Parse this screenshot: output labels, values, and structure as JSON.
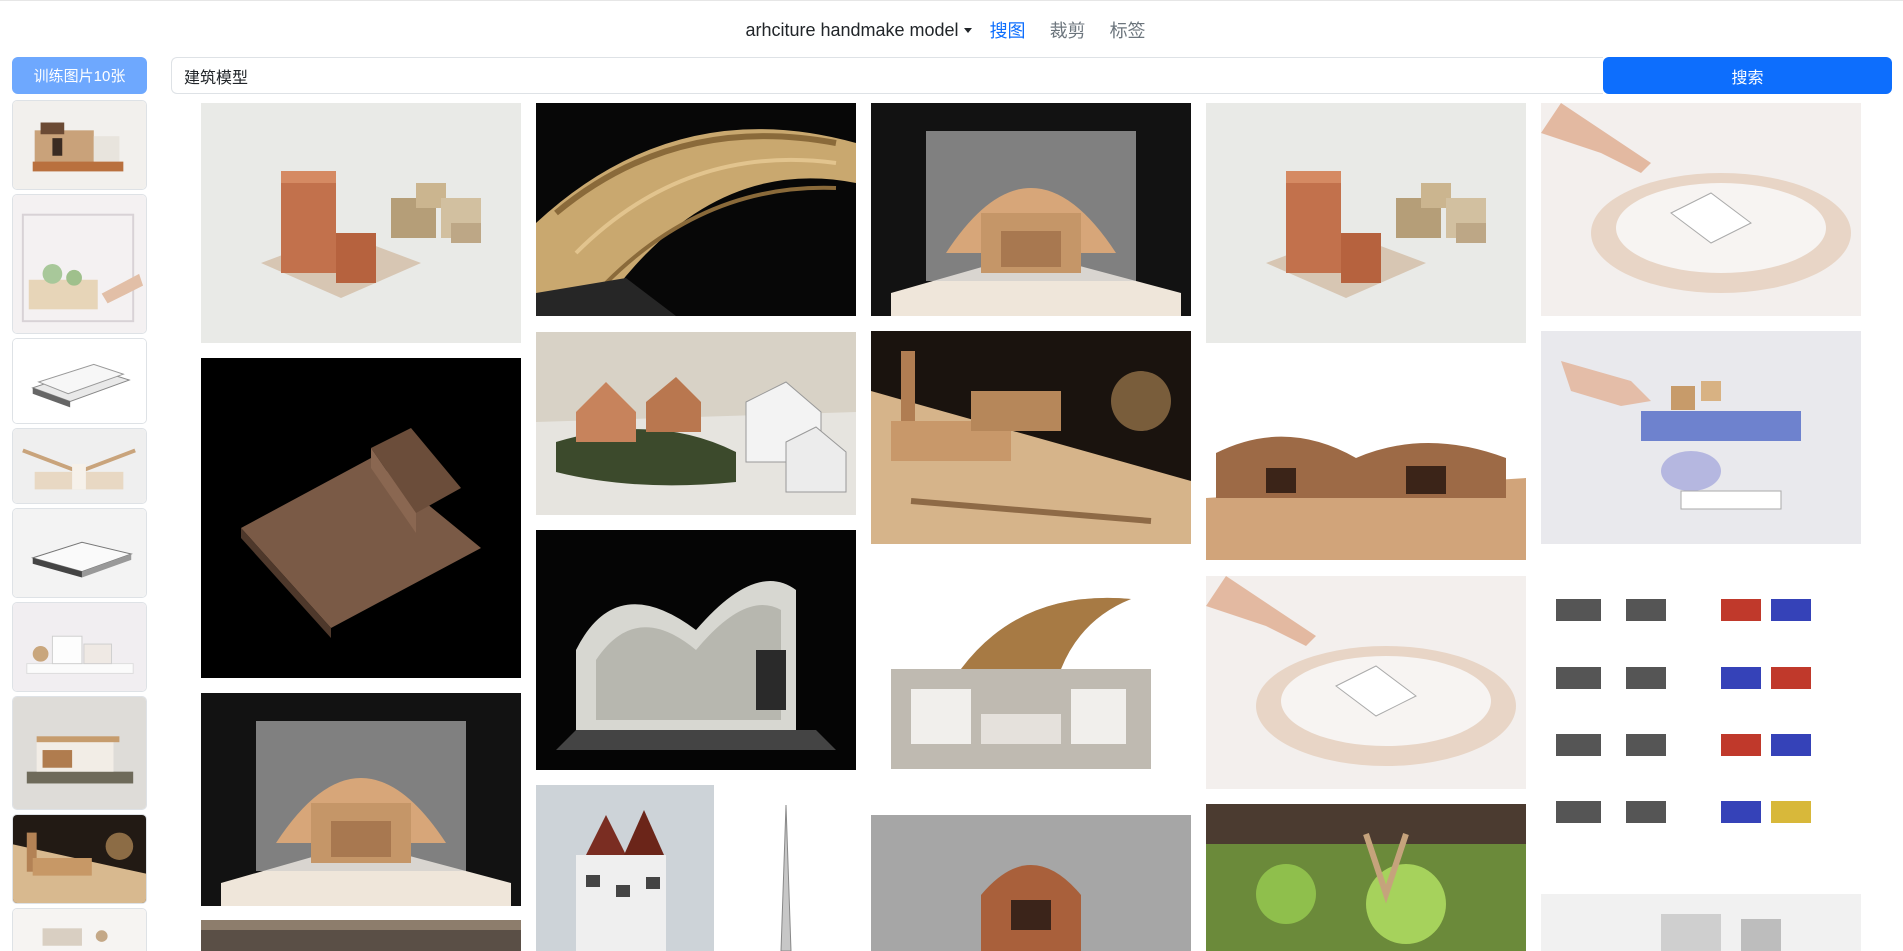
{
  "nav": {
    "dataset_label": "arhciture handmake model",
    "tabs": [
      {
        "label": "搜图",
        "active": true
      },
      {
        "label": "裁剪",
        "active": false
      },
      {
        "label": "标签",
        "active": false
      }
    ]
  },
  "sidebar": {
    "train_button": "训练图片10张",
    "thumbnails": [
      {
        "name": "cutaway-house-model"
      },
      {
        "name": "acrylic-box-model-with-hand"
      },
      {
        "name": "white-stacked-slabs-model"
      },
      {
        "name": "butterfly-roof-model"
      },
      {
        "name": "white-thin-block-model"
      },
      {
        "name": "white-cube-house-model"
      },
      {
        "name": "wooden-pavilion-model"
      },
      {
        "name": "factory-site-model"
      },
      {
        "name": "white-site-model"
      }
    ]
  },
  "search": {
    "query": "建筑模型",
    "button": "搜索"
  },
  "results": [
    {
      "name": "terracotta-block-model"
    },
    {
      "name": "wooden-lattice-arch-model"
    },
    {
      "name": "timber-vault-section-model"
    },
    {
      "name": "terracotta-block-model-duplicate"
    },
    {
      "name": "ring-model-with-hand"
    },
    {
      "name": "dark-wooden-block-model"
    },
    {
      "name": "village-landscape-model"
    },
    {
      "name": "factory-site-model"
    },
    {
      "name": "curved-roof-wood-model"
    },
    {
      "name": "hand-placing-blocks-model"
    },
    {
      "name": "timber-vault-section-model-duplicate"
    },
    {
      "name": "white-stick-pavilion-model"
    },
    {
      "name": "concrete-section-model"
    },
    {
      "name": "ring-model-with-hand-duplicate"
    },
    {
      "name": "block-sequence-diagram"
    },
    {
      "name": "sculptural-clay-model"
    },
    {
      "name": "capsule-tower-models"
    },
    {
      "name": "clay-hut-model"
    },
    {
      "name": "green-landscape-tower-model"
    },
    {
      "name": "grey-building-model"
    }
  ]
}
